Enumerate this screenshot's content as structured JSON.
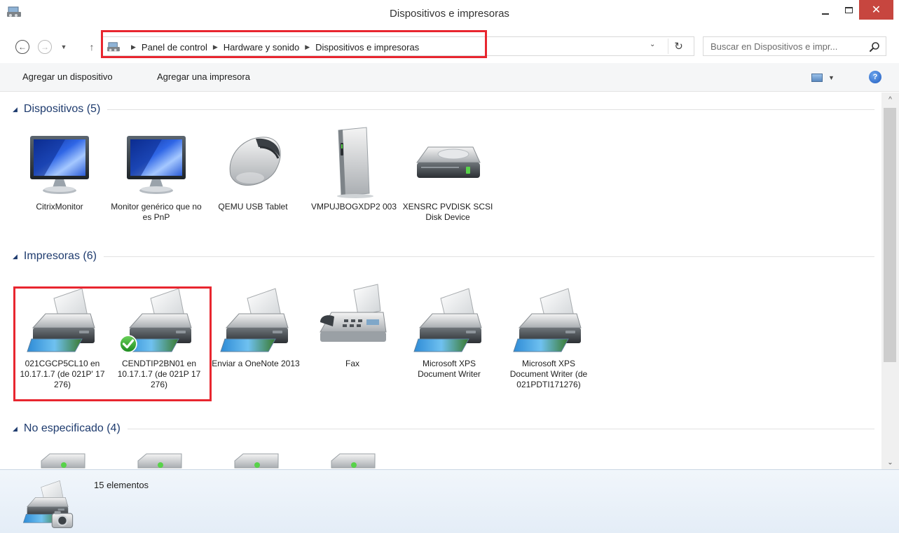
{
  "window": {
    "title": "Dispositivos e impresoras",
    "close_glyph": "✕"
  },
  "nav": {
    "back_glyph": "←",
    "forward_glyph": "→",
    "recent_glyph": "▼",
    "up_glyph": "↑"
  },
  "address": {
    "crumbs": [
      "Panel de control",
      "Hardware y sonido",
      "Dispositivos e impresoras"
    ],
    "separator": "▶",
    "dropdown_glyph": "⌄",
    "refresh_glyph": "↻"
  },
  "search": {
    "placeholder": "Buscar en Dispositivos e impr..."
  },
  "commands": {
    "add_device": "Agregar un dispositivo",
    "add_printer": "Agregar una impresora",
    "view_drop_glyph": "▼",
    "help_glyph": "?"
  },
  "groups": {
    "devices": {
      "label": "Dispositivos (5)",
      "items": [
        {
          "label": "CitrixMonitor",
          "icon": "monitor-icon"
        },
        {
          "label": "Monitor genérico que no es PnP",
          "icon": "monitor-icon"
        },
        {
          "label": "QEMU USB Tablet",
          "icon": "mouse-icon"
        },
        {
          "label": "VMPUJBOGXDP2 003",
          "icon": "computer-tower-icon"
        },
        {
          "label": "XENSRC PVDISK SCSI Disk Device",
          "icon": "hard-drive-icon"
        }
      ]
    },
    "printers": {
      "label": "Impresoras (6)",
      "items": [
        {
          "label": "021CGCP5CL10 en 10.17.1.7 (de 021P'   17  276)",
          "icon": "printer-icon"
        },
        {
          "label": "CENDTIP2BN01 en 10.17.1.7 (de 021P     17  276)",
          "icon": "printer-icon",
          "default": true
        },
        {
          "label": "Enviar a OneNote 2013",
          "icon": "printer-icon"
        },
        {
          "label": "Fax",
          "icon": "fax-icon"
        },
        {
          "label": "Microsoft XPS Document Writer",
          "icon": "printer-icon"
        },
        {
          "label": "Microsoft XPS Document Writer (de 021PDTI171276)",
          "icon": "printer-icon"
        }
      ]
    },
    "unspecified": {
      "label": "No especificado (4)",
      "count": 4
    }
  },
  "scrollbar": {
    "up_glyph": "^",
    "down_glyph": "⌄"
  },
  "details": {
    "count": "15 elementos"
  },
  "colors": {
    "group_heading": "#1e3b6e",
    "highlight_box": "#e8262f",
    "close_button": "#c7463f"
  }
}
